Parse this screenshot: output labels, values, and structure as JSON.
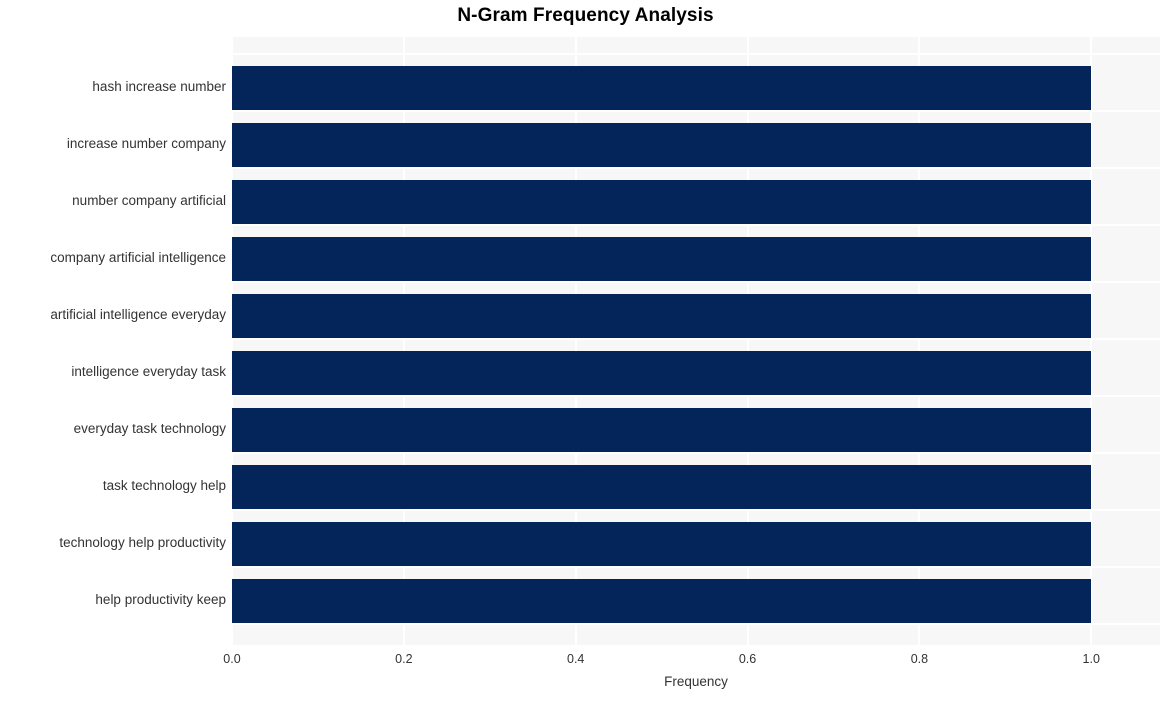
{
  "chart_data": {
    "type": "bar",
    "orientation": "horizontal",
    "title": "N-Gram Frequency Analysis",
    "xlabel": "Frequency",
    "ylabel": "",
    "categories": [
      "hash increase number",
      "increase number company",
      "number company artificial",
      "company artificial intelligence",
      "artificial intelligence everyday",
      "intelligence everyday task",
      "everyday task technology",
      "task technology help",
      "technology help productivity",
      "help productivity keep"
    ],
    "values": [
      1.0,
      1.0,
      1.0,
      1.0,
      1.0,
      1.0,
      1.0,
      1.0,
      1.0,
      1.0
    ],
    "xlim": [
      0.0,
      1.08
    ],
    "xticks": [
      "0.0",
      "0.2",
      "0.4",
      "0.6",
      "0.8",
      "1.0"
    ],
    "xtick_values": [
      0.0,
      0.2,
      0.4,
      0.6,
      0.8,
      1.0
    ],
    "grid": true,
    "grid_color": "#ffffff",
    "plot_background": "#f7f7f7",
    "bar_color": "#03255a",
    "legend": null
  }
}
